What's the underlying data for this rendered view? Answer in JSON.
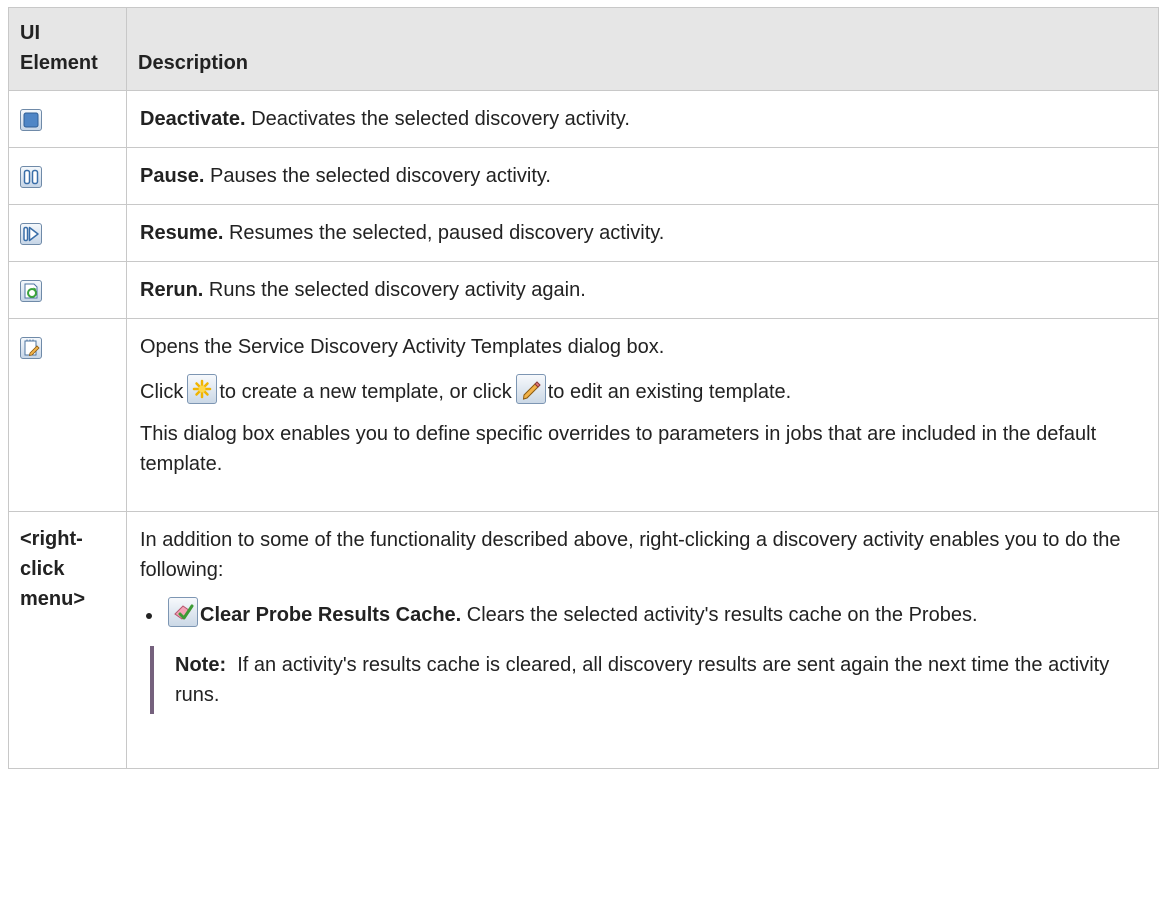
{
  "table": {
    "headers": {
      "ui_element": "UI Element",
      "description": "Description"
    },
    "rows": {
      "deactivate": {
        "icon": "deactivate-icon",
        "title": "Deactivate.",
        "text": "Deactivates the selected discovery activity."
      },
      "pause": {
        "icon": "pause-icon",
        "title": "Pause.",
        "text": "Pauses the selected discovery activity."
      },
      "resume": {
        "icon": "resume-icon",
        "title": "Resume.",
        "text": "Resumes the selected, paused discovery activity."
      },
      "rerun": {
        "icon": "rerun-icon",
        "title": "Rerun.",
        "text": "Runs the selected discovery activity again."
      },
      "templates": {
        "icon": "templates-icon",
        "line1": "Opens the Service Discovery Activity Templates dialog box.",
        "line2": {
          "click": "Click",
          "create": "to create a new template, or click",
          "edit": "to edit an existing template.",
          "new_icon": "new-template-icon",
          "edit_icon": "edit-template-icon"
        },
        "line3": "This dialog box enables you to define specific overrides to parameters in jobs that are included in the default template."
      },
      "right_click": {
        "element": "<right-click menu>",
        "intro": "In addition to some of the functionality described above, right-clicking a discovery activity enables you to do the following:",
        "item": {
          "icon": "clear-cache-icon",
          "title": "Clear Probe Results Cache.",
          "text": "Clears the selected activity's results cache on the Probes."
        },
        "note": {
          "label": "Note:",
          "text": "If an activity's results cache is cleared, all discovery results are sent again the next time the activity runs."
        }
      }
    }
  },
  "colors": {
    "header_bg": "#e6e6e6",
    "border": "#c8c8c8",
    "note_bar": "#75617d",
    "text": "#222222"
  }
}
